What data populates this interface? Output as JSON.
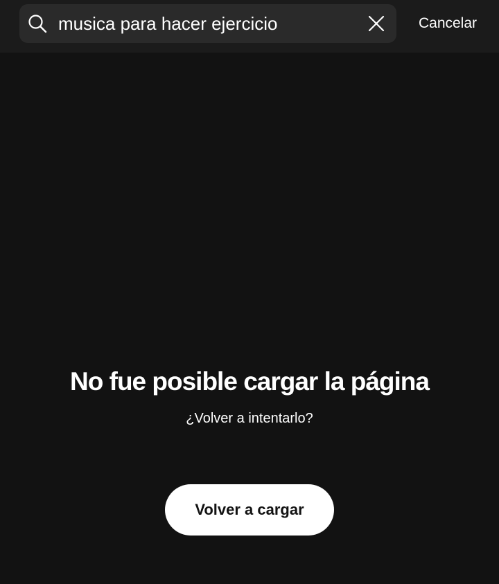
{
  "search": {
    "value": "musica para hacer ejercicio",
    "icon": "search-icon",
    "clear_icon": "close-icon"
  },
  "header": {
    "cancel_label": "Cancelar"
  },
  "error": {
    "title": "No fue posible cargar la página",
    "subtitle": "¿Volver a intentarlo?",
    "reload_label": "Volver a cargar"
  },
  "colors": {
    "background": "#121212",
    "header_background": "#1b1b1b",
    "search_background": "#2a2a2a",
    "text": "#ffffff",
    "button_background": "#ffffff",
    "button_text": "#121212"
  }
}
